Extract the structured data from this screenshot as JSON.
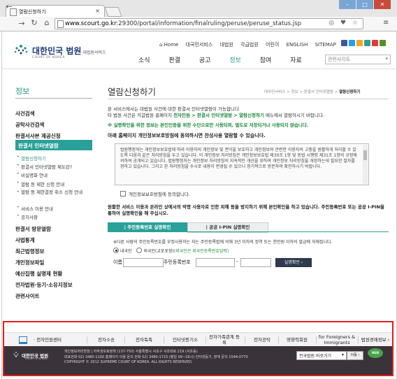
{
  "browser": {
    "tab_title": "열람신청하기",
    "url_host": "www.scourt.go.kr",
    "url_path": ":29300/portal/information/finalruling/peruse/peruse_status.jsp",
    "window_min": "–",
    "window_max": "□",
    "window_close": "✕"
  },
  "header": {
    "logo_title": "대한민국 법원",
    "logo_small": "대법원서비스",
    "logo_sub": "COURT OF KOREA",
    "util_nav": [
      "⌂ Home",
      "대국민서비스",
      "대법원",
      "각급법원",
      "어린이",
      "ENGLISH",
      "SITEMAP"
    ],
    "main_nav": [
      "소식",
      "판결",
      "공고",
      "정보",
      "참여",
      "자료"
    ],
    "main_nav_active": "정보",
    "search_placeholder": "관련사이트",
    "sns_colors": [
      "#3b5998",
      "#1da1f2",
      "#f5a623",
      "#2aa198",
      "#e53935",
      "#5b8c2a"
    ]
  },
  "sidebar": {
    "title": "정보",
    "items": [
      "사건검색",
      "공탁사건검색",
      "판결서사본 제공신청"
    ],
    "active": "판결서 인터넷열람",
    "sub_items": [
      "열람신청하기",
      "판결서 인터넷열람 제도란?",
      "비실명화 안내",
      "열람 등 제한 신청 안내",
      "열람 등 제한결정 취소 신청 안내",
      "서비스 이용 안내",
      "공지사항"
    ],
    "items_after": [
      "판결서 방문열람",
      "사법통계",
      "최근법령정보",
      "개인정보파일",
      "예산집행 실명제 현황",
      "전자법원·등기·소유지정보",
      "관련사이트"
    ]
  },
  "main": {
    "title": "열람신청하기",
    "breadcrumb": [
      "대국민서비스",
      "정보",
      "판결서 인터넷열람",
      "열람신청하기"
    ],
    "intro_line1": "본 서비스에서는 대법원 사건에 대한 판결서 인터넷열람이 가능합니다.",
    "intro_line2_a": "타 법원 사건은 각급법원 홈페이지 ",
    "intro_line2_b": "전자민원 > 판결서 인터넷열람 > 열람신청하기",
    "intro_line2_c": " 메뉴에서 열람하시기 바랍니다.",
    "intro_warn": "※ 실명확인을 위한 정보는 본인인증을 위한 수단으로만 사용되며, 별도로 저장되거나 사용되지 않습니다.",
    "consent_question": "아래 홈페이지 개인정보보호방침에 동의하시면 찬성사용 열람할 수 있습니다.",
    "consent_text": "법원행정처는 개인정보보호법에 따라 이용자의 개인정보 및 권익을 보호하고 개인정보와 관련한 이용자의 고충을 원활하게 처리할 수 있도록 다음과 같은 처리방침을 두고 있습니다. 이 개인정보 처리방침은 개인정보보호법 제30조 1항 및 동법 시행령 제31조 1항의 규정에 의하여 공개되고 있습니다. 법원행정처는 개인정보 처리방침의 지속적인 개선을 위하여 개인정보 처리방침을 개정하는데 필요한 절차를 정하고 있습니다. 그리고 본 처리방침을 수시로 내용이 변경될 수 있으니 정기적으로 방문하여 확인하시기 바랍니다.",
    "agree_label": "개인정보보호방침에 동의합니다.",
    "notice": "원활한 서비스 이용과 온라인 상에서의 악명 사용자로 인한 피해 등을 방지하기 위해 본인확인을 하고 있습니다. 주민등록번호 또는 공공 I-PIN을 통하여 실명확인을 해 주십시오.",
    "tab_resident": "| 주민등록번호 실명확인",
    "tab_ipin": "| 공공 I-PIN 실명확인",
    "auth_note": "※다른 사람의 주민등록번호를 부정사용하는 자는 주민등록법에 의해 3년 이하의 징역 또는 천만원 이하의 벌금에 처해집니다.",
    "opt_domestic": "내국인",
    "opt_foreign": "외국인(교포포함)",
    "opt_foreign_link": "(외국인은 외국인등록번호입력)",
    "label_name": "이름",
    "label_rrn": "주민등록번호",
    "rrn_dash": "-",
    "verify_button": "실명확인 ›"
  },
  "footer": {
    "nav": [
      "· 전자민원센터",
      "전자소송",
      "전자독촉",
      "인터넷등기소",
      "전자가족관계 등록",
      "전자공탁",
      "영향력회원",
      "for Foreigners & Immigrants",
      "법원경매정보 ›"
    ],
    "logo": "대한민국 법원",
    "logo_sub": "COURT OF KOREA",
    "line1": "개인정보처리방침 | 저작권보호정책 (137-750) 서울특별시 서초구 서초대로 219 (서초동)",
    "line2": "대표전화 02) 3480-1100 홈페이지 이용 문의 전화 02) 3480-1715 (평일 09~18시) 인터넷등기, 장애 문의 1544-0770",
    "line3": "COPYRIGHT © 2012 SUPREME COURT OF KOREA. ALL RIGHTS RESERVED.",
    "select_value": "전국법원 바로가기",
    "go_button": "이동 ›",
    "badge": "WEB"
  }
}
